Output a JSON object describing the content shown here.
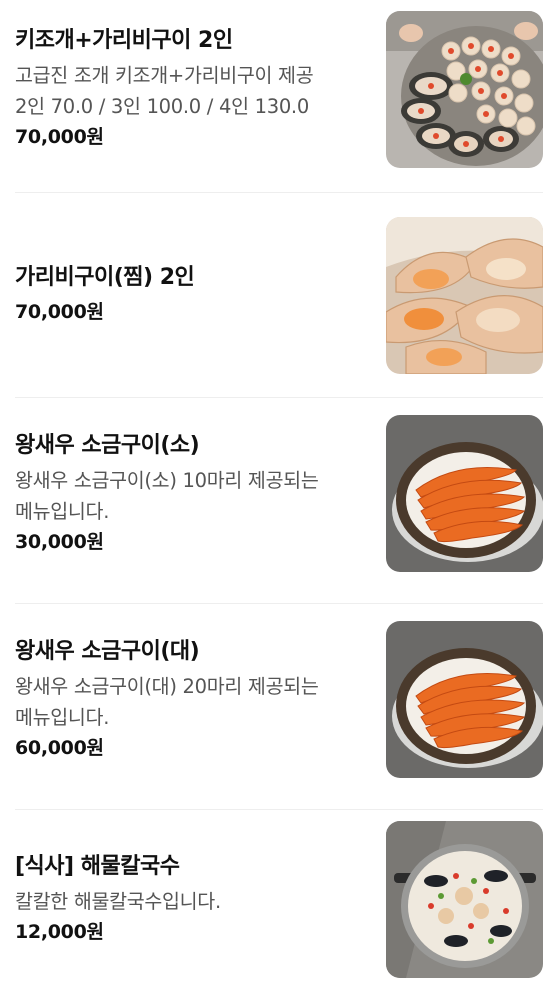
{
  "menu": {
    "items": [
      {
        "name": "키조개+가리비구이 2인",
        "description": "고급진 조개 키조개+가리비구이 제공\n2인 70.0 / 3인 100.0 / 4인 130.0",
        "price": "70,000원",
        "image_icon": "scallop-platter-photo"
      },
      {
        "name": "가리비구이(찜) 2인",
        "description": "",
        "price": "70,000원",
        "image_icon": "scallop-shells-photo"
      },
      {
        "name": "왕새우 소금구이(소)",
        "description": "왕새우 소금구이(소) 10마리 제공되는\n메뉴입니다.",
        "price": "30,000원",
        "image_icon": "grilled-shrimp-bowl-photo"
      },
      {
        "name": "왕새우 소금구이(대)",
        "description": "왕새우 소금구이(대) 20마리 제공되는\n메뉴입니다.",
        "price": "60,000원",
        "image_icon": "grilled-shrimp-bowl-photo"
      },
      {
        "name": "[식사] 해물칼국수",
        "description": "칼칼한 해물칼국수입니다.",
        "price": "12,000원",
        "image_icon": "seafood-noodle-pot-photo"
      }
    ]
  }
}
